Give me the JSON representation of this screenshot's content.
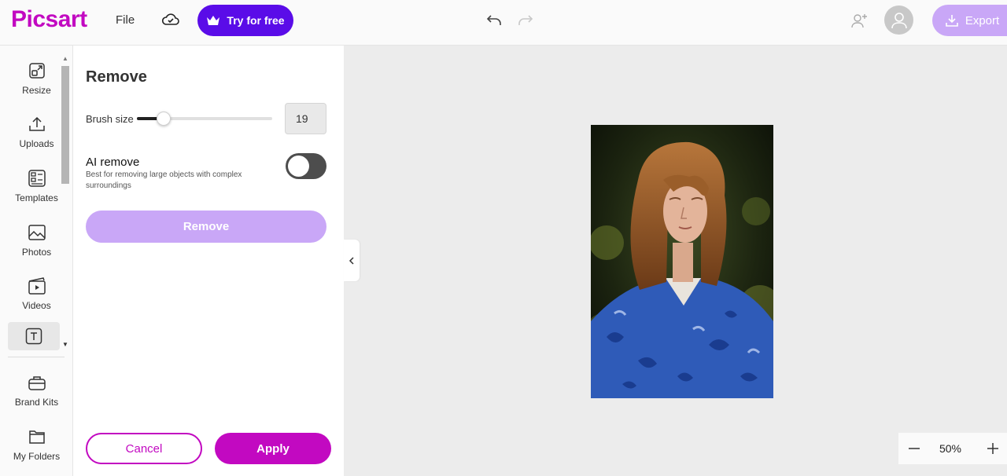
{
  "header": {
    "logo": "Picsart",
    "file_label": "File",
    "try_label": "Try for free",
    "export_label": "Export"
  },
  "rail": {
    "items": [
      {
        "label": "Resize",
        "icon": "resize-icon"
      },
      {
        "label": "Uploads",
        "icon": "upload-icon"
      },
      {
        "label": "Templates",
        "icon": "templates-icon"
      },
      {
        "label": "Photos",
        "icon": "photo-icon"
      },
      {
        "label": "Videos",
        "icon": "video-icon"
      },
      {
        "label": "",
        "icon": "text-icon"
      },
      {
        "label": "Brand Kits",
        "icon": "brand-kit-icon"
      },
      {
        "label": "My Folders",
        "icon": "folder-icon"
      }
    ]
  },
  "panel": {
    "title": "Remove",
    "brush_label": "Brush size",
    "brush_value": "19",
    "brush_fraction": 0.2,
    "ai_title": "AI remove",
    "ai_desc": "Best for removing large objects with complex surroundings",
    "ai_enabled": false,
    "remove_label": "Remove",
    "cancel_label": "Cancel",
    "apply_label": "Apply"
  },
  "zoom": {
    "value": "50%"
  },
  "colors": {
    "brand": "#c209c1",
    "try": "#5a0ce8",
    "export": "#c9a7f7"
  }
}
